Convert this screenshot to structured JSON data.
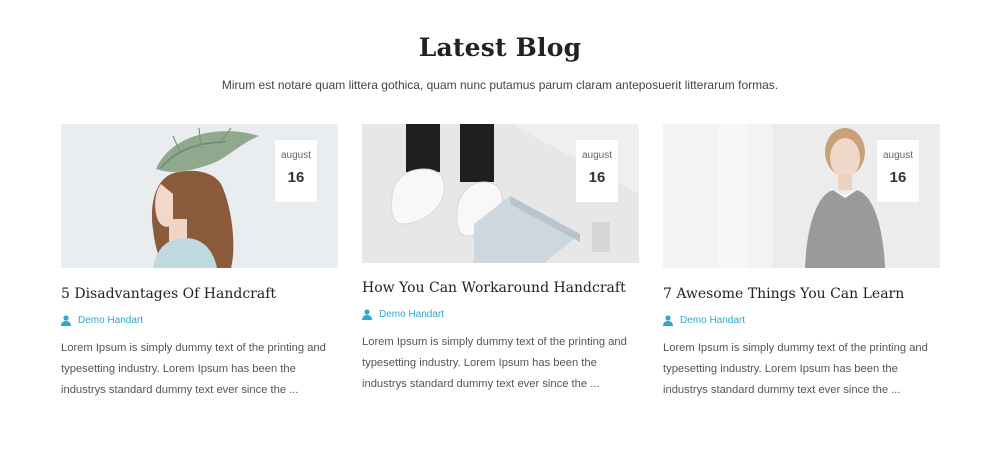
{
  "section": {
    "title": "Latest Blog",
    "subtitle": "Mirum est notare quam littera gothica, quam nunc putamus parum claram anteposuerit litterarum formas."
  },
  "posts": [
    {
      "month": "august",
      "day": "16",
      "title": "5 Disadvantages Of Handcraft",
      "author": "Demo Handart",
      "excerpt": "Lorem Ipsum is simply dummy text of the printing and typesetting industry. Lorem Ipsum has been the industrys standard dummy text ever since the ..."
    },
    {
      "month": "august",
      "day": "16",
      "title": "How You Can Workaround Handcraft",
      "author": "Demo Handart",
      "excerpt": "Lorem Ipsum is simply dummy text of the printing and typesetting industry. Lorem Ipsum has been the industrys standard dummy text ever since the ..."
    },
    {
      "month": "august",
      "day": "16",
      "title": "7 Awesome Things You Can Learn",
      "author": "Demo Handart",
      "excerpt": "Lorem Ipsum is simply dummy text of the printing and typesetting industry. Lorem Ipsum has been the industrys standard dummy text ever since the ..."
    }
  ],
  "colors": {
    "accent": "#2fa8c9",
    "title": "#222222",
    "text": "#555555"
  },
  "icons": {
    "author": "user-icon"
  }
}
